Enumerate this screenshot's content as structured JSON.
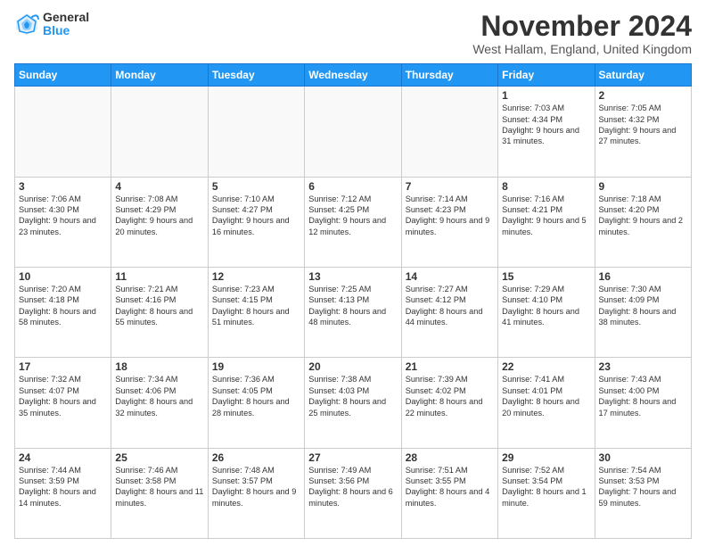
{
  "header": {
    "logo_general": "General",
    "logo_blue": "Blue",
    "title": "November 2024",
    "location": "West Hallam, England, United Kingdom"
  },
  "days_of_week": [
    "Sunday",
    "Monday",
    "Tuesday",
    "Wednesday",
    "Thursday",
    "Friday",
    "Saturday"
  ],
  "weeks": [
    [
      {
        "day": "",
        "content": ""
      },
      {
        "day": "",
        "content": ""
      },
      {
        "day": "",
        "content": ""
      },
      {
        "day": "",
        "content": ""
      },
      {
        "day": "",
        "content": ""
      },
      {
        "day": "1",
        "content": "Sunrise: 7:03 AM\nSunset: 4:34 PM\nDaylight: 9 hours and 31 minutes."
      },
      {
        "day": "2",
        "content": "Sunrise: 7:05 AM\nSunset: 4:32 PM\nDaylight: 9 hours and 27 minutes."
      }
    ],
    [
      {
        "day": "3",
        "content": "Sunrise: 7:06 AM\nSunset: 4:30 PM\nDaylight: 9 hours and 23 minutes."
      },
      {
        "day": "4",
        "content": "Sunrise: 7:08 AM\nSunset: 4:29 PM\nDaylight: 9 hours and 20 minutes."
      },
      {
        "day": "5",
        "content": "Sunrise: 7:10 AM\nSunset: 4:27 PM\nDaylight: 9 hours and 16 minutes."
      },
      {
        "day": "6",
        "content": "Sunrise: 7:12 AM\nSunset: 4:25 PM\nDaylight: 9 hours and 12 minutes."
      },
      {
        "day": "7",
        "content": "Sunrise: 7:14 AM\nSunset: 4:23 PM\nDaylight: 9 hours and 9 minutes."
      },
      {
        "day": "8",
        "content": "Sunrise: 7:16 AM\nSunset: 4:21 PM\nDaylight: 9 hours and 5 minutes."
      },
      {
        "day": "9",
        "content": "Sunrise: 7:18 AM\nSunset: 4:20 PM\nDaylight: 9 hours and 2 minutes."
      }
    ],
    [
      {
        "day": "10",
        "content": "Sunrise: 7:20 AM\nSunset: 4:18 PM\nDaylight: 8 hours and 58 minutes."
      },
      {
        "day": "11",
        "content": "Sunrise: 7:21 AM\nSunset: 4:16 PM\nDaylight: 8 hours and 55 minutes."
      },
      {
        "day": "12",
        "content": "Sunrise: 7:23 AM\nSunset: 4:15 PM\nDaylight: 8 hours and 51 minutes."
      },
      {
        "day": "13",
        "content": "Sunrise: 7:25 AM\nSunset: 4:13 PM\nDaylight: 8 hours and 48 minutes."
      },
      {
        "day": "14",
        "content": "Sunrise: 7:27 AM\nSunset: 4:12 PM\nDaylight: 8 hours and 44 minutes."
      },
      {
        "day": "15",
        "content": "Sunrise: 7:29 AM\nSunset: 4:10 PM\nDaylight: 8 hours and 41 minutes."
      },
      {
        "day": "16",
        "content": "Sunrise: 7:30 AM\nSunset: 4:09 PM\nDaylight: 8 hours and 38 minutes."
      }
    ],
    [
      {
        "day": "17",
        "content": "Sunrise: 7:32 AM\nSunset: 4:07 PM\nDaylight: 8 hours and 35 minutes."
      },
      {
        "day": "18",
        "content": "Sunrise: 7:34 AM\nSunset: 4:06 PM\nDaylight: 8 hours and 32 minutes."
      },
      {
        "day": "19",
        "content": "Sunrise: 7:36 AM\nSunset: 4:05 PM\nDaylight: 8 hours and 28 minutes."
      },
      {
        "day": "20",
        "content": "Sunrise: 7:38 AM\nSunset: 4:03 PM\nDaylight: 8 hours and 25 minutes."
      },
      {
        "day": "21",
        "content": "Sunrise: 7:39 AM\nSunset: 4:02 PM\nDaylight: 8 hours and 22 minutes."
      },
      {
        "day": "22",
        "content": "Sunrise: 7:41 AM\nSunset: 4:01 PM\nDaylight: 8 hours and 20 minutes."
      },
      {
        "day": "23",
        "content": "Sunrise: 7:43 AM\nSunset: 4:00 PM\nDaylight: 8 hours and 17 minutes."
      }
    ],
    [
      {
        "day": "24",
        "content": "Sunrise: 7:44 AM\nSunset: 3:59 PM\nDaylight: 8 hours and 14 minutes."
      },
      {
        "day": "25",
        "content": "Sunrise: 7:46 AM\nSunset: 3:58 PM\nDaylight: 8 hours and 11 minutes."
      },
      {
        "day": "26",
        "content": "Sunrise: 7:48 AM\nSunset: 3:57 PM\nDaylight: 8 hours and 9 minutes."
      },
      {
        "day": "27",
        "content": "Sunrise: 7:49 AM\nSunset: 3:56 PM\nDaylight: 8 hours and 6 minutes."
      },
      {
        "day": "28",
        "content": "Sunrise: 7:51 AM\nSunset: 3:55 PM\nDaylight: 8 hours and 4 minutes."
      },
      {
        "day": "29",
        "content": "Sunrise: 7:52 AM\nSunset: 3:54 PM\nDaylight: 8 hours and 1 minute."
      },
      {
        "day": "30",
        "content": "Sunrise: 7:54 AM\nSunset: 3:53 PM\nDaylight: 7 hours and 59 minutes."
      }
    ]
  ]
}
